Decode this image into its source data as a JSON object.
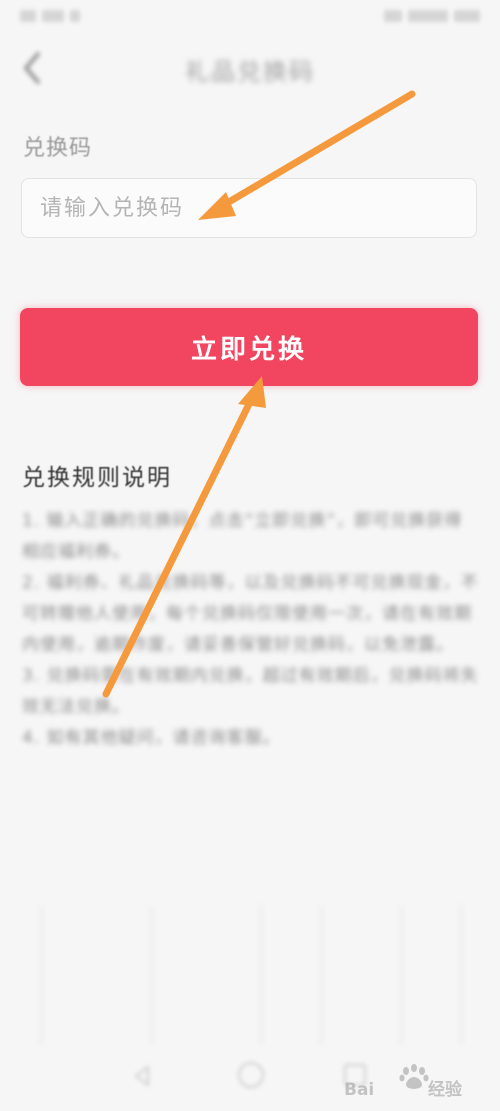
{
  "header": {
    "title": "礼品兑换码"
  },
  "form": {
    "code_label": "兑换码",
    "code_placeholder": "请输入兑换码",
    "code_value": ""
  },
  "redeem_button": {
    "label": "立即兑换"
  },
  "rules": {
    "title": "兑换规则说明",
    "items": [
      "1. 输入正确的兑换码，点击“立即兑换”，即可兑换获得相应福利券。",
      "2. 福利券、礼品兑换码等，以及兑换码不可兑换现金，不可转赠他人使用，每个兑换码仅限使用一次，请在有效期内使用，逾期作废，请妥善保管好兑换码，以免泄露。",
      "3. 兑换码需在有效期内兑换，超过有效期后，兑换码将失效无法兑换。",
      "4. 如有其他疑问，请咨询客服。"
    ]
  },
  "colors": {
    "accent": "#f24560",
    "arrow": "#f59a3c"
  }
}
